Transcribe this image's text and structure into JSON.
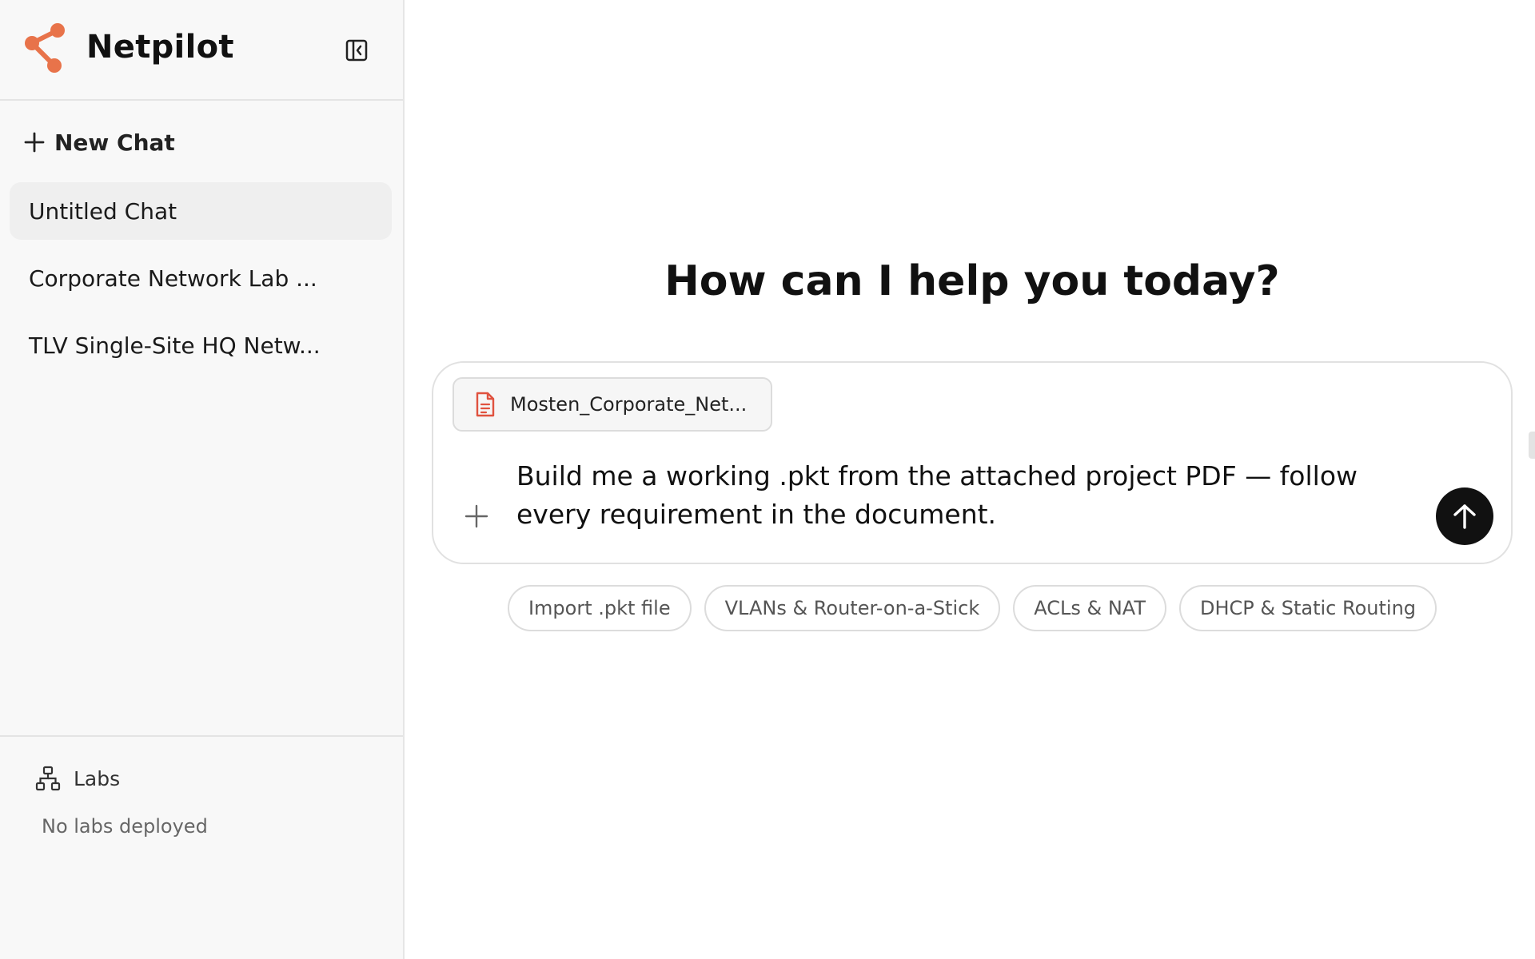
{
  "sidebar": {
    "app_name": "Netpilot",
    "logo_icon": "share-nodes-icon",
    "collapse_icon": "sidebar-collapse-icon",
    "new_chat_label": "New Chat",
    "chats": [
      {
        "label": "Untitled Chat",
        "active": true
      },
      {
        "label": "Corporate Network Lab ...",
        "active": false
      },
      {
        "label": "TLV Single-Site HQ Netw...",
        "active": false
      }
    ],
    "labs": {
      "label": "Labs",
      "icon": "network-topology-icon",
      "empty_text": "No labs deployed"
    }
  },
  "main": {
    "heading": "How can I help you today?",
    "composer": {
      "attachment_name": "Mosten_Corporate_Net...",
      "attachment_icon": "pdf-document-icon",
      "prompt_text": "Build me a working .pkt from the attached project PDF — follow every requirement in the document.",
      "add_icon": "plus-icon",
      "send_icon": "arrow-up-icon"
    },
    "suggestions": [
      "Import .pkt file",
      "VLANs & Router-on-a-Stick",
      "ACLs & NAT",
      "DHCP & Static Routing"
    ]
  },
  "colors": {
    "brand_accent": "#E8734A",
    "send_button": "#111111",
    "sidebar_bg": "#F8F8F8",
    "attachment_icon": "#E0523F"
  }
}
